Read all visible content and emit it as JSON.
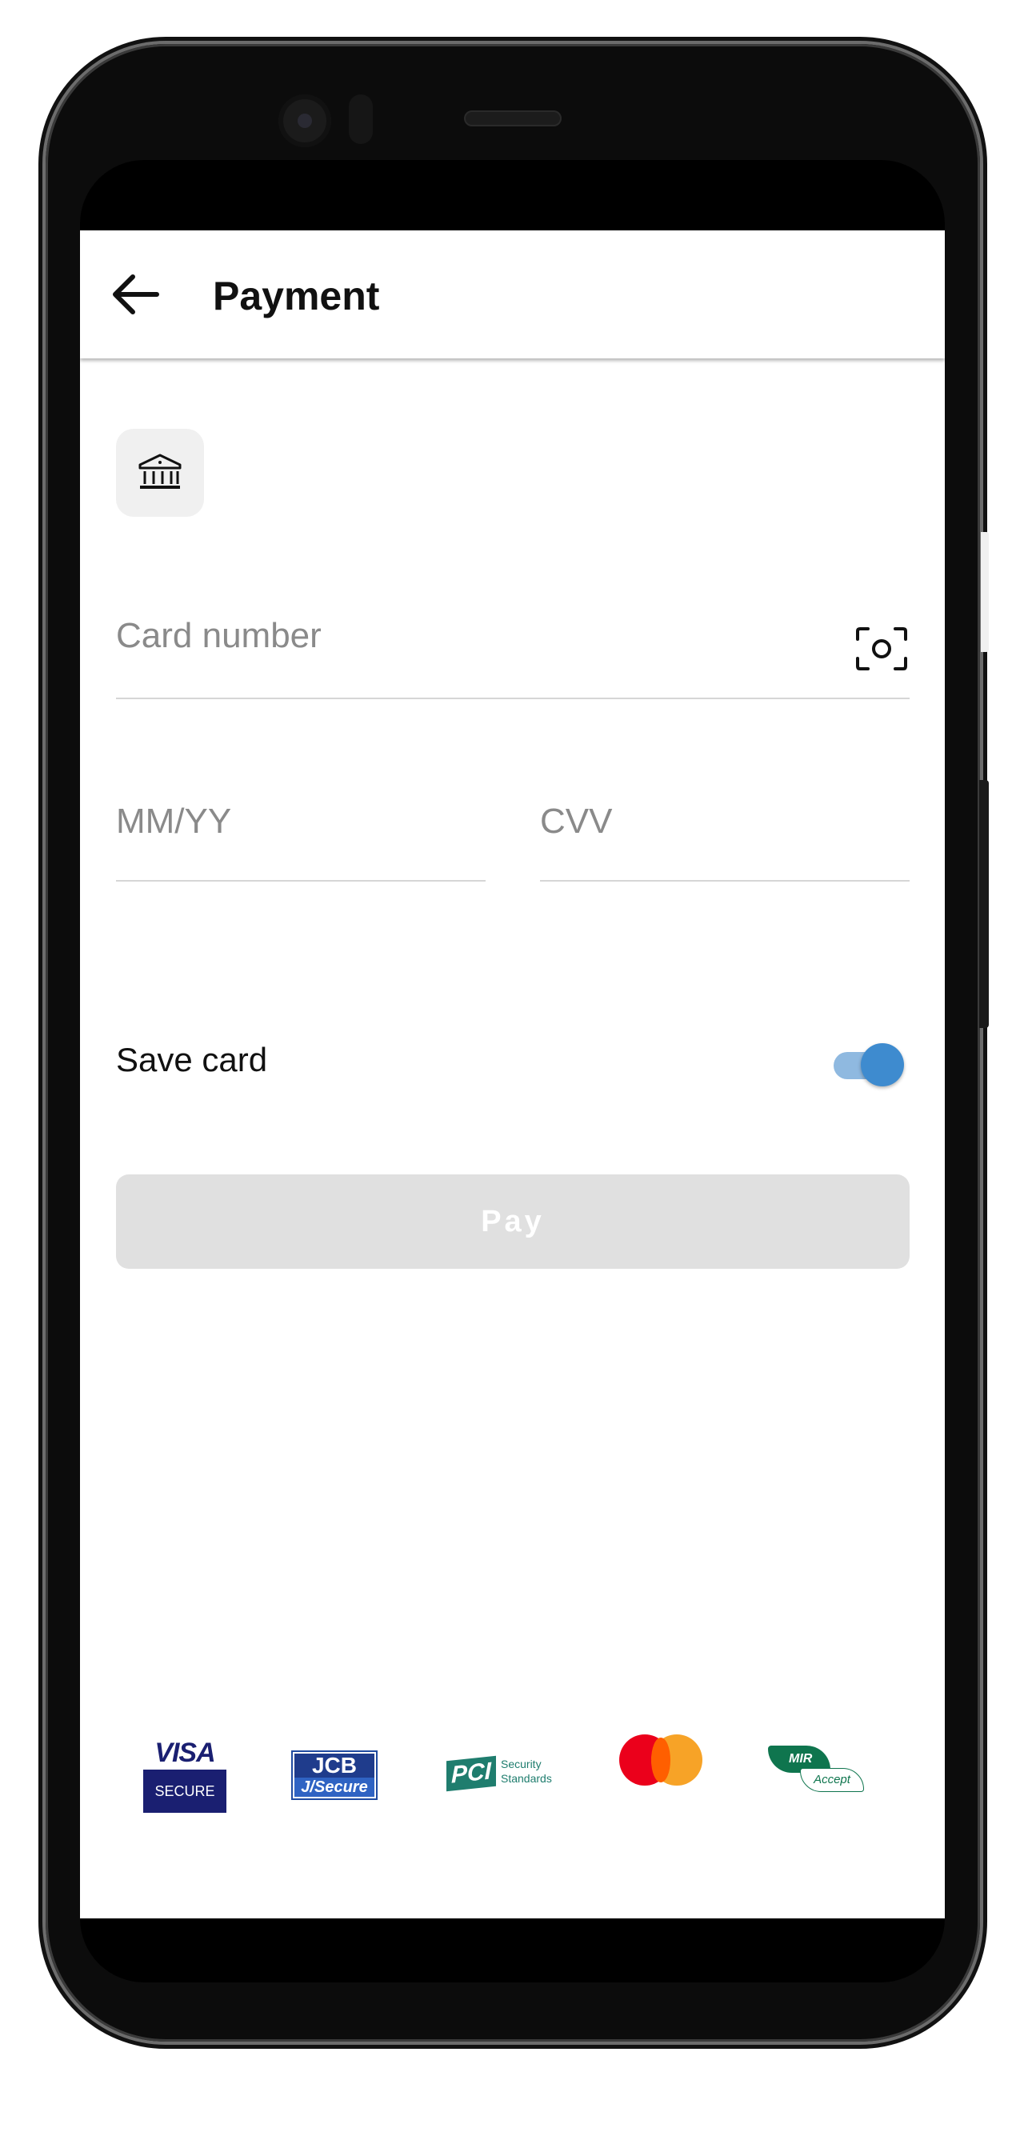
{
  "appbar": {
    "back_icon": "arrow-left-icon",
    "title": "Payment"
  },
  "payment_method": {
    "icon": "bank-icon"
  },
  "form": {
    "card_number_placeholder": "Card number",
    "scan_icon": "camera-scan-icon",
    "expiry_placeholder": "MM/YY",
    "cvv_placeholder": "CVV"
  },
  "save_card": {
    "label": "Save card",
    "enabled": true
  },
  "pay_button": {
    "label": "Pay",
    "enabled": false
  },
  "logos": {
    "visa_top": "VISA",
    "visa_bottom": "SECURE",
    "jcb_top": "JCB",
    "jcb_bottom": "J/Secure",
    "pci_mark": "PCI",
    "pci_line1": "Security",
    "pci_line2": "Standards",
    "mastercard": "mastercard-logo",
    "mir_top": "MIR",
    "mir_bottom": "Accept"
  },
  "colors": {
    "accent": "#3e8bcf",
    "accent_track": "#8fb9e0",
    "disabled_button": "#e0e0e0",
    "placeholder": "#8a8a8a"
  }
}
